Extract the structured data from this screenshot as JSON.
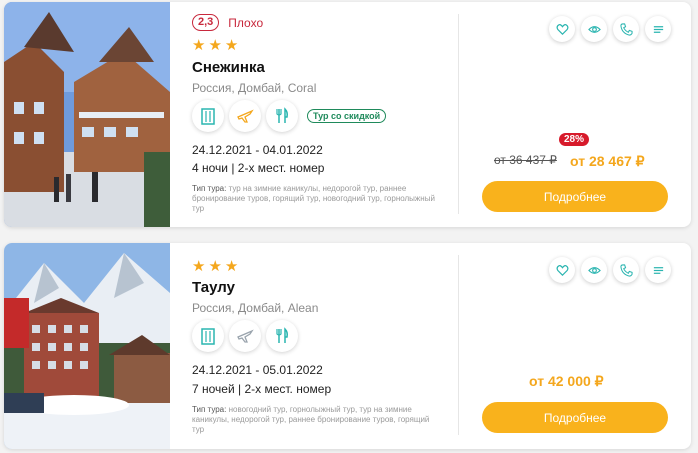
{
  "colors": {
    "accent": "#f9b21c",
    "price": "#f4a71d",
    "rating": "#c8283c",
    "discount_tag": "#1f8a5b",
    "icon_teal": "#2ab5b0"
  },
  "cards": [
    {
      "rating": {
        "score": "2,3",
        "label": "Плохо"
      },
      "stars": [
        "★",
        "★",
        "★"
      ],
      "name": "Снежинка",
      "location": "Россия, Домбай, Coral",
      "amenity_icons": [
        "building-icon",
        "plane-icon",
        "cutlery-icon"
      ],
      "discount_tag": "Тур со скидкой",
      "dates": "24.12.2021 - 04.01.2022",
      "nights": "4 ночи | 2-х мест. номер",
      "tags_label": "Тип тура:",
      "tags": "тур на зимние каникулы, недорогой тур, раннее бронирование туров, горящий тур, новогодний тур, горнолыжный тур",
      "discount_pct": "28%",
      "old_price": "от 36 437 ₽",
      "price": "от 28 467 ₽",
      "button": "Подробнее"
    },
    {
      "stars": [
        "★",
        "★",
        "★"
      ],
      "name": "Таулу",
      "location": "Россия, Домбай, Alean",
      "amenity_icons": [
        "building-icon",
        "plane-icon",
        "cutlery-icon"
      ],
      "dates": "24.12.2021 - 05.01.2022",
      "nights": "7 ночей | 2-х мест. номер",
      "tags_label": "Тип тура:",
      "tags": "новогодний тур, горнолыжный тур, тур на зимние каникулы, недорогой тур, раннее бронирование туров, горящий тур",
      "price": "от 42 000 ₽",
      "button": "Подробнее"
    }
  ],
  "action_icons": [
    "heart-icon",
    "eye-icon",
    "phone-icon",
    "filter-icon"
  ]
}
